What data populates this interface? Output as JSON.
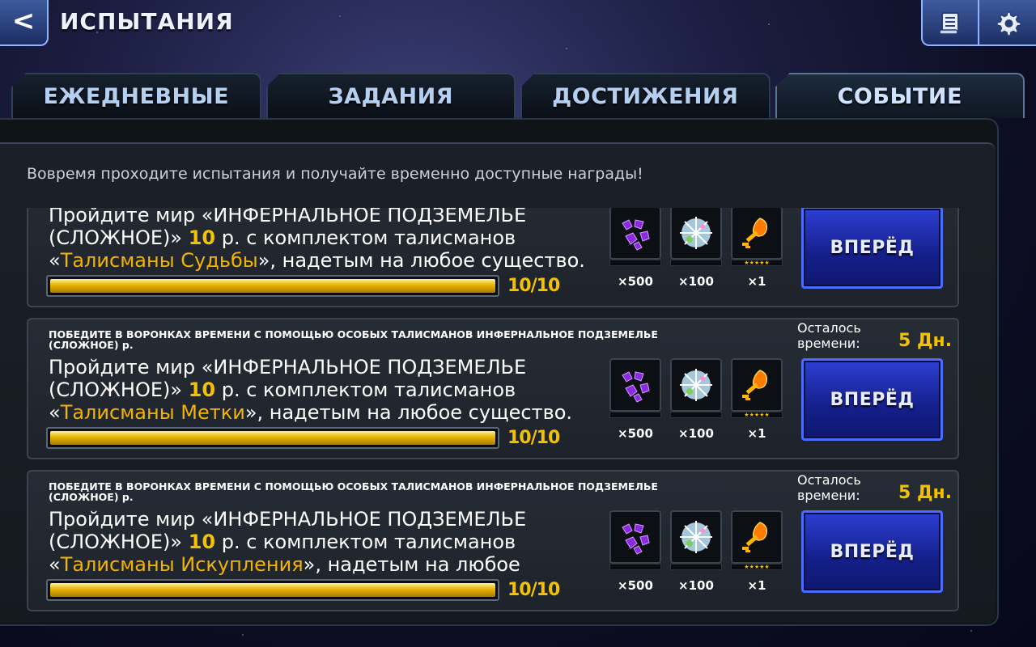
{
  "header": {
    "back_label": "<",
    "title": "ИСПЫТАНИЯ",
    "scroll_icon": "scroll-icon",
    "settings_icon": "gear-icon"
  },
  "tabs": [
    {
      "label": "ЕЖЕДНЕВНЫЕ",
      "active": false
    },
    {
      "label": "ЗАДАНИЯ",
      "active": false
    },
    {
      "label": "ДОСТИЖЕНИЯ",
      "active": false
    },
    {
      "label": "СОБЫТИЕ",
      "active": true
    }
  ],
  "subtitle": "Вовремя проходите испытания и получайте временно доступные награды!",
  "colors": {
    "accent_gold": "#f2c200",
    "button_blue": "#1c2bb0"
  },
  "cards": [
    {
      "heading": "",
      "desc_pre": "Пройдите мир «ИНФЕРНАЛЬНОЕ ПОДЗЕМЕЛЬЕ (СЛОЖНОЕ)» ",
      "desc_num": "10",
      "desc_mid": " р. с комплектом талисманов «",
      "desc_hl": "Талисманы Судьбы",
      "desc_post": "», надетым на любое существо.",
      "progress_text": "10/10",
      "progress_fraction": 1.0,
      "timer_label": "",
      "timer_value": "",
      "rewards": [
        {
          "icon": "purple-shard-icon",
          "qty": "×500",
          "stars": ""
        },
        {
          "icon": "crystal-orb-icon",
          "qty": "×100",
          "stars": ""
        },
        {
          "icon": "flame-key-icon",
          "qty": "×1",
          "stars": "★★★★★"
        }
      ],
      "button_label": "ВПЕРЁД"
    },
    {
      "heading": "ПОБЕДИТЕ В ВОРОНКАХ ВРЕМЕНИ С ПОМОЩЬЮ ОСОБЫХ ТАЛИСМАНОВ ИНФЕРНАЛЬНОЕ ПОДЗЕМЕЛЬЕ (СЛОЖНОЕ) р.",
      "desc_pre": "Пройдите мир «ИНФЕРНАЛЬНОЕ ПОДЗЕМЕЛЬЕ (СЛОЖНОЕ)» ",
      "desc_num": "10",
      "desc_mid": " р. с комплектом талисманов «",
      "desc_hl": "Талисманы Метки",
      "desc_post": "», надетым на любое существо.",
      "progress_text": "10/10",
      "progress_fraction": 1.0,
      "timer_label": "Осталось времени:",
      "timer_value": "5 Дн.",
      "rewards": [
        {
          "icon": "purple-shard-icon",
          "qty": "×500",
          "stars": ""
        },
        {
          "icon": "crystal-orb-icon",
          "qty": "×100",
          "stars": ""
        },
        {
          "icon": "flame-key-icon",
          "qty": "×1",
          "stars": "★★★★★"
        }
      ],
      "button_label": "ВПЕРЁД"
    },
    {
      "heading": "ПОБЕДИТЕ В ВОРОНКАХ ВРЕМЕНИ С ПОМОЩЬЮ ОСОБЫХ ТАЛИСМАНОВ ИНФЕРНАЛЬНОЕ ПОДЗЕМЕЛЬЕ (СЛОЖНОЕ) р.",
      "desc_pre": "Пройдите мир «ИНФЕРНАЛЬНОЕ ПОДЗЕМЕЛЬЕ (СЛОЖНОЕ)» ",
      "desc_num": "10",
      "desc_mid": " р. с комплектом талисманов «",
      "desc_hl": "Талисманы Искупления",
      "desc_post": "», надетым на любое существо.",
      "progress_text": "10/10",
      "progress_fraction": 1.0,
      "timer_label": "Осталось времени:",
      "timer_value": "5 Дн.",
      "rewards": [
        {
          "icon": "purple-shard-icon",
          "qty": "×500",
          "stars": ""
        },
        {
          "icon": "crystal-orb-icon",
          "qty": "×100",
          "stars": ""
        },
        {
          "icon": "flame-key-icon",
          "qty": "×1",
          "stars": "★★★★★"
        }
      ],
      "button_label": "ВПЕРЁД"
    }
  ]
}
